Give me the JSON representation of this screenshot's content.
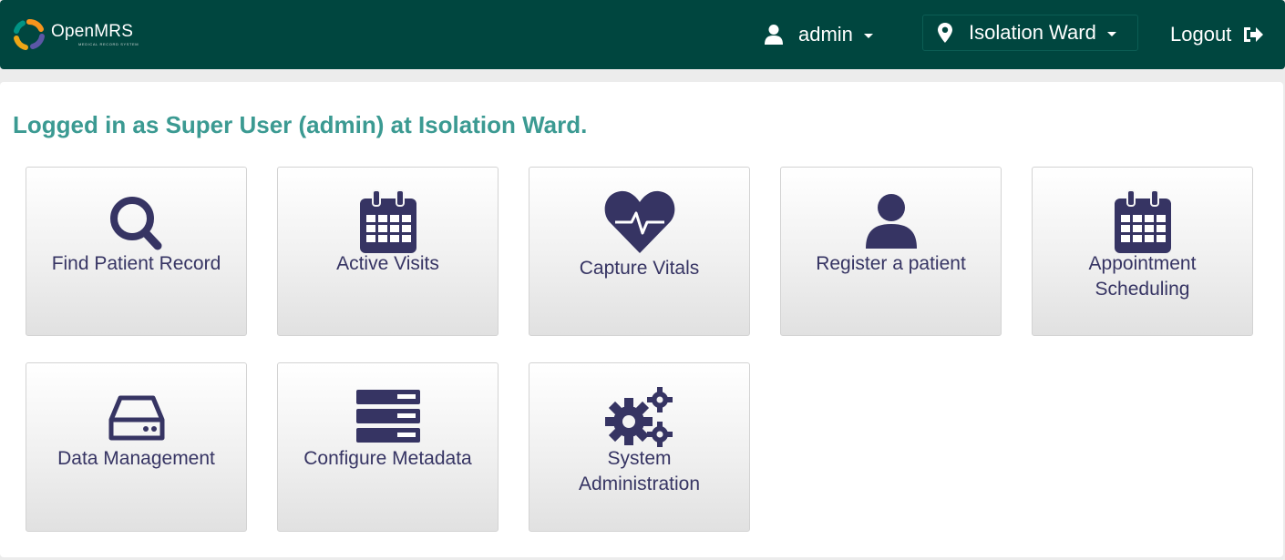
{
  "header": {
    "logo_name": "OpenMRS",
    "logo_subtitle": "MEDICAL RECORD SYSTEM",
    "user": {
      "icon": "user-icon",
      "label": "admin"
    },
    "location": {
      "icon": "map-marker-icon",
      "label": "Isolation Ward"
    },
    "logout": {
      "label": "Logout",
      "icon": "sign-out-icon"
    }
  },
  "main": {
    "welcome": "Logged in as Super User (admin) at Isolation Ward.",
    "apps": [
      {
        "label": "Find Patient Record",
        "icon": "search-icon"
      },
      {
        "label": "Active Visits",
        "icon": "calendar-icon"
      },
      {
        "label": "Capture Vitals",
        "icon": "heartbeat-icon"
      },
      {
        "label": "Register a patient",
        "icon": "user-icon"
      },
      {
        "label": "Appointment Scheduling",
        "icon": "calendar-icon"
      },
      {
        "label": "Data Management",
        "icon": "hard-drive-icon"
      },
      {
        "label": "Configure Metadata",
        "icon": "server-icon"
      },
      {
        "label": "System Administration",
        "icon": "gears-icon"
      }
    ]
  },
  "colors": {
    "header_bg": "#00463f",
    "accent": "#3b9a92",
    "icon": "#363463"
  }
}
